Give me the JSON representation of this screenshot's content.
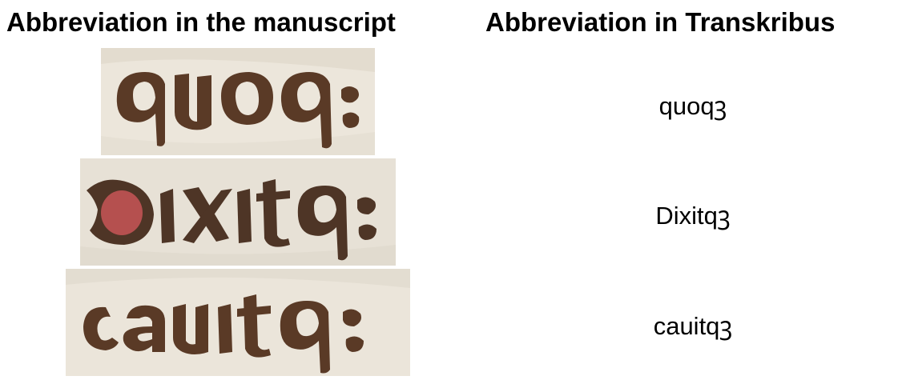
{
  "headers": {
    "manuscript": "Abbreviation in the manuscript",
    "transkribus": "Abbreviation in Transkribus"
  },
  "rows": [
    {
      "image_label": "quoq;",
      "transkribus": "quoqꝫ"
    },
    {
      "image_label": "Dixitq;",
      "transkribus": "Dixitqꝫ"
    },
    {
      "image_label": "cauitq;",
      "transkribus": "cauitqꝫ"
    }
  ],
  "colors": {
    "parchment": "#ece6db",
    "ink": "#5a3a26",
    "rubric": "#b5504f"
  }
}
